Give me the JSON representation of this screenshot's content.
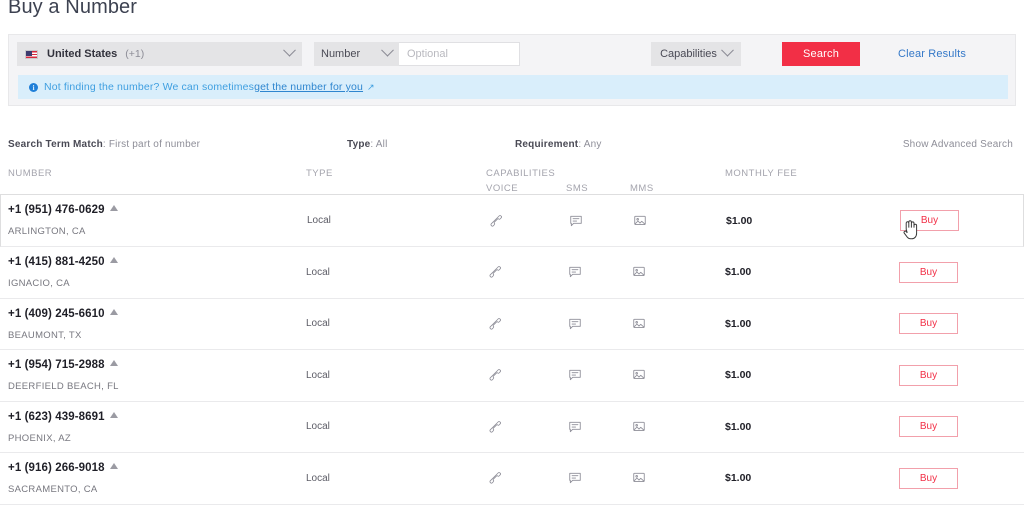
{
  "page": {
    "title": "Buy a Number"
  },
  "search": {
    "country": {
      "name": "United States",
      "code": "(+1)",
      "flag_icon": "us-flag-icon"
    },
    "number_type_select": {
      "label": "Number"
    },
    "search_field": {
      "value": "",
      "placeholder": "Optional"
    },
    "capabilities_select": {
      "label": "Capabilities"
    },
    "search_button": "Search",
    "clear_results": "Clear Results"
  },
  "banner": {
    "icon": "info-icon",
    "text": "Not finding the number? We can sometimes ",
    "link": "get the number for you",
    "external_arrow": "↗"
  },
  "filters": {
    "search_term_match_label": "Search Term Match",
    "search_term_match_value": ": First part of number",
    "type_label": "Type",
    "type_value": ": All",
    "requirement_label": "Requirement",
    "requirement_value": ": Any",
    "advanced_search": "Show Advanced Search"
  },
  "table": {
    "headers": {
      "number": "NUMBER",
      "type": "TYPE",
      "capabilities": "CAPABILITIES",
      "voice": "VOICE",
      "sms": "SMS",
      "mms": "MMS",
      "monthly_fee": "MONTHLY FEE"
    },
    "buy_label": "Buy",
    "rows": [
      {
        "number": "+1 (951) 476-0629",
        "location": "ARLINGTON, CA",
        "type": "Local",
        "voice": true,
        "sms": true,
        "mms": true,
        "fee": "$1.00",
        "buy": "Buy"
      },
      {
        "number": "+1 (415) 881-4250",
        "location": "IGNACIO, CA",
        "type": "Local",
        "voice": true,
        "sms": true,
        "mms": true,
        "fee": "$1.00",
        "buy": "Buy"
      },
      {
        "number": "+1 (409) 245-6610",
        "location": "BEAUMONT, TX",
        "type": "Local",
        "voice": true,
        "sms": true,
        "mms": true,
        "fee": "$1.00",
        "buy": "Buy"
      },
      {
        "number": "+1 (954) 715-2988",
        "location": "DEERFIELD BEACH, FL",
        "type": "Local",
        "voice": true,
        "sms": true,
        "mms": true,
        "fee": "$1.00",
        "buy": "Buy"
      },
      {
        "number": "+1 (623) 439-8691",
        "location": "PHOENIX, AZ",
        "type": "Local",
        "voice": true,
        "sms": true,
        "mms": true,
        "fee": "$1.00",
        "buy": "Buy"
      },
      {
        "number": "+1 (916) 266-9018",
        "location": "SACRAMENTO, CA",
        "type": "Local",
        "voice": true,
        "sms": true,
        "mms": true,
        "fee": "$1.00",
        "buy": "Buy"
      }
    ]
  },
  "colors": {
    "brand_red": "#f22f46",
    "link_blue": "#3478c8",
    "banner_bg": "#d9eefb",
    "panel_bg": "#f4f4f6"
  }
}
